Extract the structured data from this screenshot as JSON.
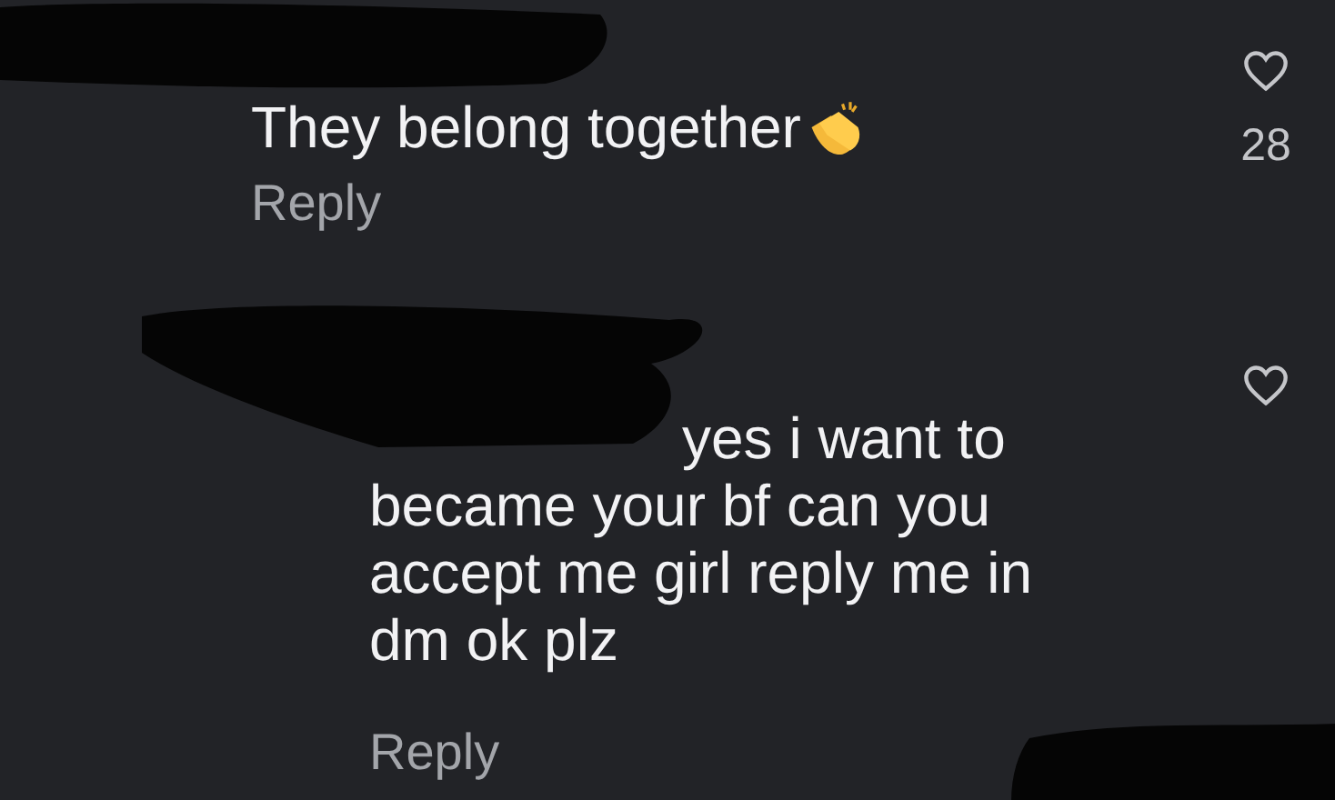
{
  "comments": [
    {
      "kind": "comment_with_emoji",
      "text": "They belong together",
      "reply": "Reply",
      "likes": "28"
    },
    {
      "kind": "reply",
      "text": "yes i want to became your bf can you accept me girl reply me in dm ok plz",
      "reply": "Reply"
    }
  ]
}
